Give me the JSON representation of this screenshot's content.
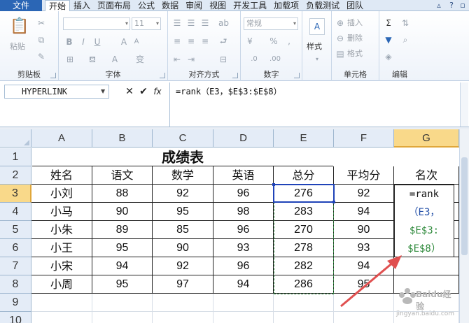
{
  "menu": {
    "file": "文件",
    "tabs": [
      "开始",
      "插入",
      "页面布局",
      "公式",
      "数据",
      "审阅",
      "视图",
      "开发工具",
      "加载项",
      "负载测试",
      "团队"
    ],
    "active_tab": "开始"
  },
  "ribbon": {
    "clipboard": {
      "label": "剪贴板",
      "paste": "粘贴"
    },
    "font": {
      "label": "字体",
      "size": "11"
    },
    "alignment": {
      "label": "对齐方式"
    },
    "number": {
      "label": "数字",
      "format": "常规"
    },
    "styles": {
      "label": "样式"
    },
    "cells": {
      "label": "单元格",
      "insert": "插入",
      "delete": "删除",
      "format": "格式"
    },
    "editing": {
      "label": "编辑"
    }
  },
  "formula_bar": {
    "name_box": "HYPERLINK",
    "cancel_icon": "x-icon",
    "enter_icon": "check-icon",
    "fx_label": "fx",
    "formula": "=rank（E3，$E$3:$E$8）"
  },
  "columns": [
    "A",
    "B",
    "C",
    "D",
    "E",
    "F",
    "G"
  ],
  "selected_column": "G",
  "rows": [
    "1",
    "2",
    "3",
    "4",
    "5",
    "6",
    "7",
    "8",
    "9",
    "10"
  ],
  "selected_row": "3",
  "sheet": {
    "title": "成绩表",
    "headers": [
      "姓名",
      "语文",
      "数学",
      "英语",
      "总分",
      "平均分",
      "名次"
    ],
    "records": [
      [
        "小刘",
        "88",
        "92",
        "96",
        "276",
        "92"
      ],
      [
        "小马",
        "90",
        "95",
        "98",
        "283",
        "94"
      ],
      [
        "小朱",
        "89",
        "85",
        "96",
        "270",
        "90"
      ],
      [
        "小王",
        "95",
        "90",
        "93",
        "278",
        "93"
      ],
      [
        "小宋",
        "94",
        "92",
        "96",
        "282",
        "94"
      ],
      [
        "小周",
        "95",
        "97",
        "94",
        "286",
        "95"
      ]
    ]
  },
  "cell_editor": {
    "line1": "=rank",
    "line2": "（E3，",
    "line3": "$E$3:",
    "line4": "$E$8）"
  },
  "watermark": {
    "brand": "Baidu经验",
    "url": "jingyan.baidu.com"
  },
  "colors": {
    "file_tab": "#2b66b5",
    "selected_header": "#f9d98a",
    "range_green": "#2f8a3c",
    "range_blue": "#1f43b8",
    "arrow_red": "#e05050"
  }
}
